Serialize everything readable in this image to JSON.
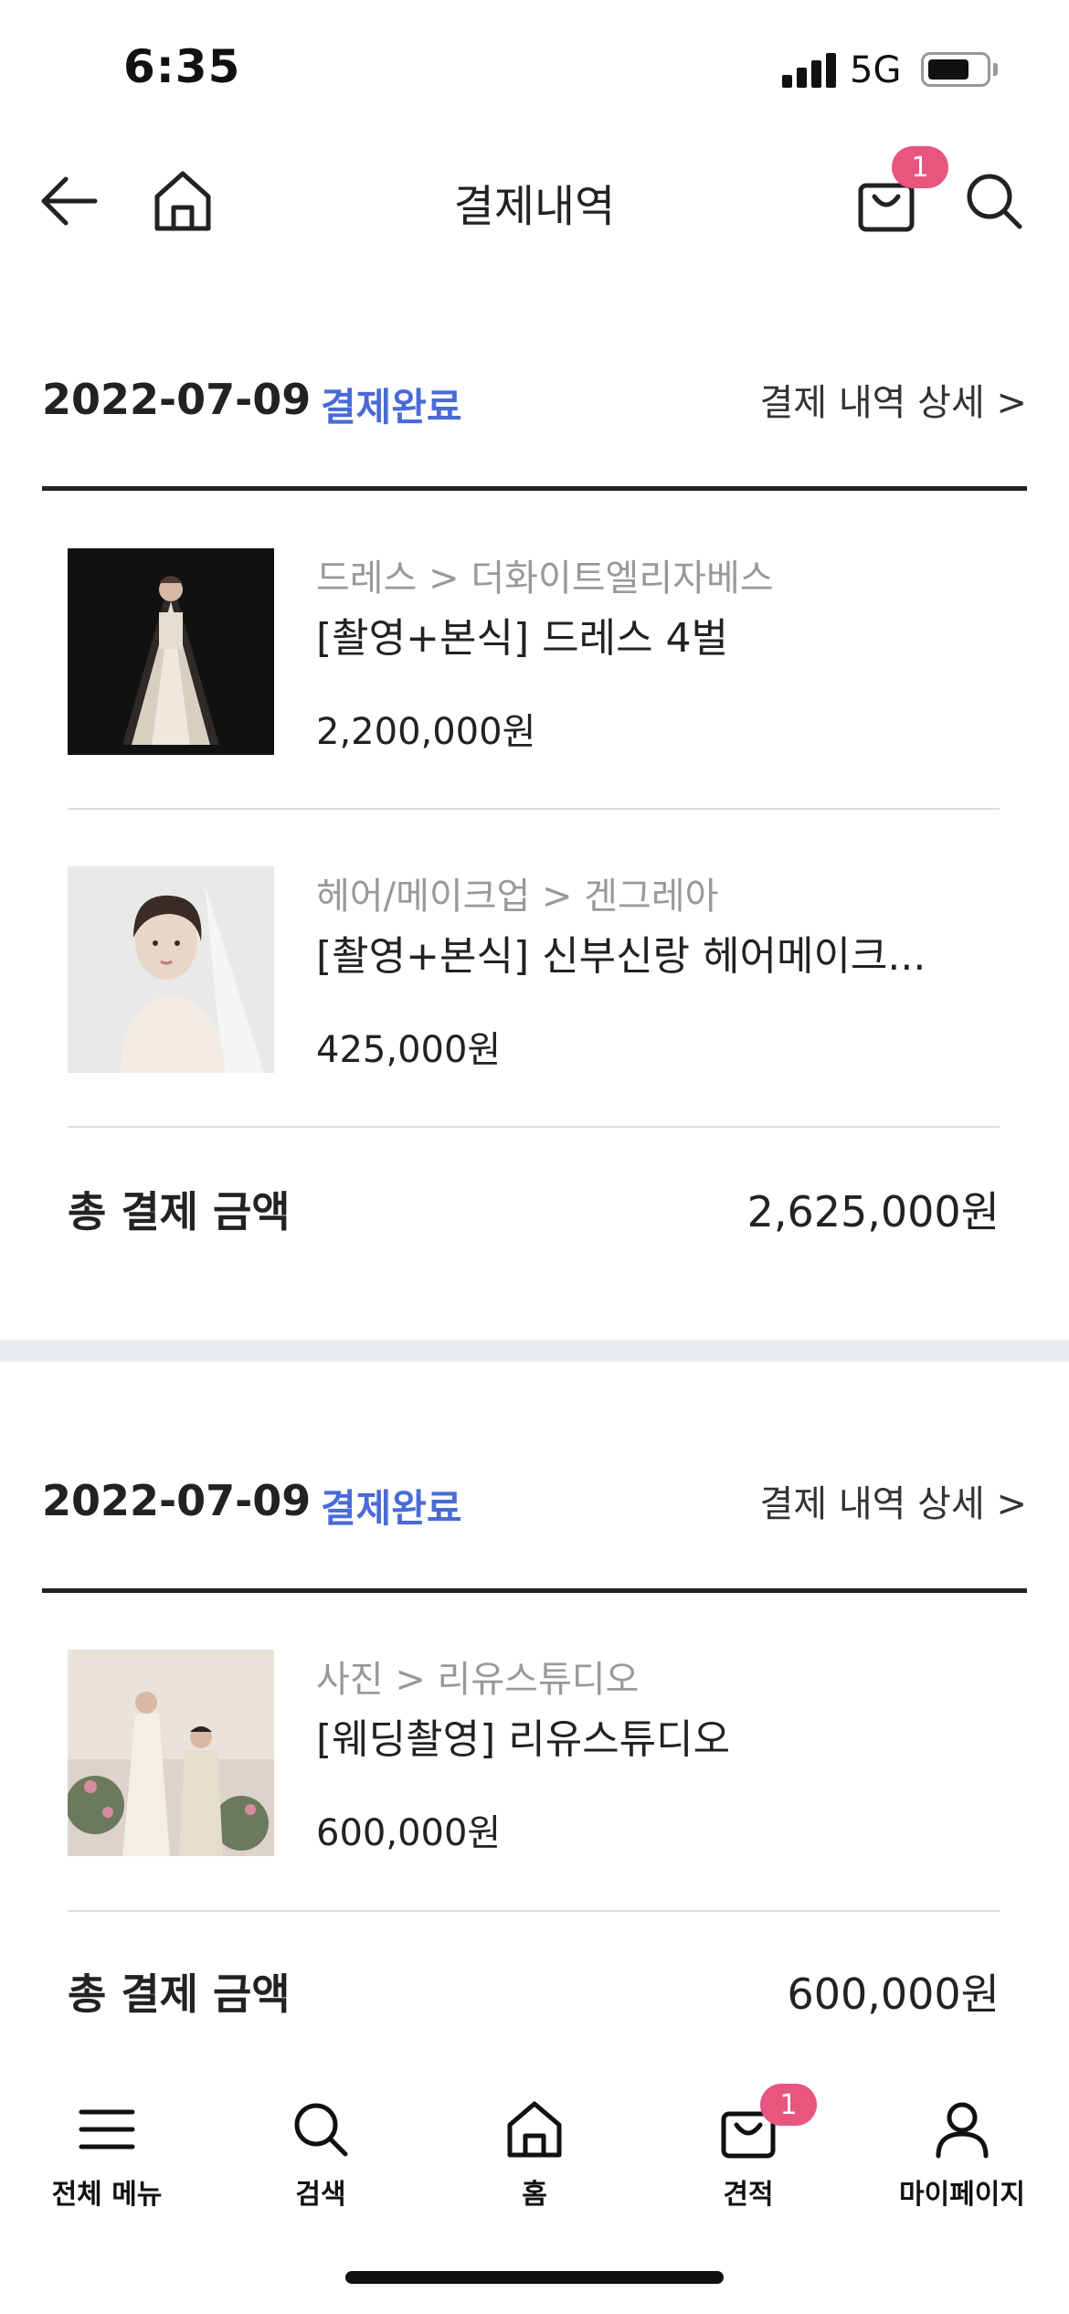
{
  "status_bar": {
    "time": "6:35",
    "network": "5G"
  },
  "header": {
    "title": "결제내역",
    "cart_count": "1"
  },
  "orders": [
    {
      "date": "2022-07-09",
      "status": "결제완료",
      "detail_link": "결제 내역 상세 >",
      "items": [
        {
          "category": "드레스 > 더화이트엘리자베스",
          "name": "[촬영+본식] 드레스 4벌",
          "price": "2,200,000원"
        },
        {
          "category": "헤어/메이크업 > 겐그레아",
          "name": "[촬영+본식] 신부신랑 헤어메이크...",
          "price": "425,000원"
        }
      ],
      "total_label": "총 결제 금액",
      "total_value": "2,625,000원"
    },
    {
      "date": "2022-07-09",
      "status": "결제완료",
      "detail_link": "결제 내역 상세 >",
      "items": [
        {
          "category": "사진 > 리유스튜디오",
          "name": "[웨딩촬영] 리유스튜디오",
          "price": "600,000원"
        }
      ],
      "total_label": "총 결제 금액",
      "total_value": "600,000원"
    }
  ],
  "bottom_nav": {
    "items": [
      {
        "label": "전체 메뉴",
        "icon": "menu-icon"
      },
      {
        "label": "검색",
        "icon": "search-icon"
      },
      {
        "label": "홈",
        "icon": "home-icon"
      },
      {
        "label": "견적",
        "icon": "bag-icon",
        "badge": "1"
      },
      {
        "label": "마이페이지",
        "icon": "person-icon"
      }
    ]
  },
  "colors": {
    "accent_blue": "#4a6bd6",
    "badge_pink": "#e8557f",
    "divider_gray": "#e8ebee"
  }
}
